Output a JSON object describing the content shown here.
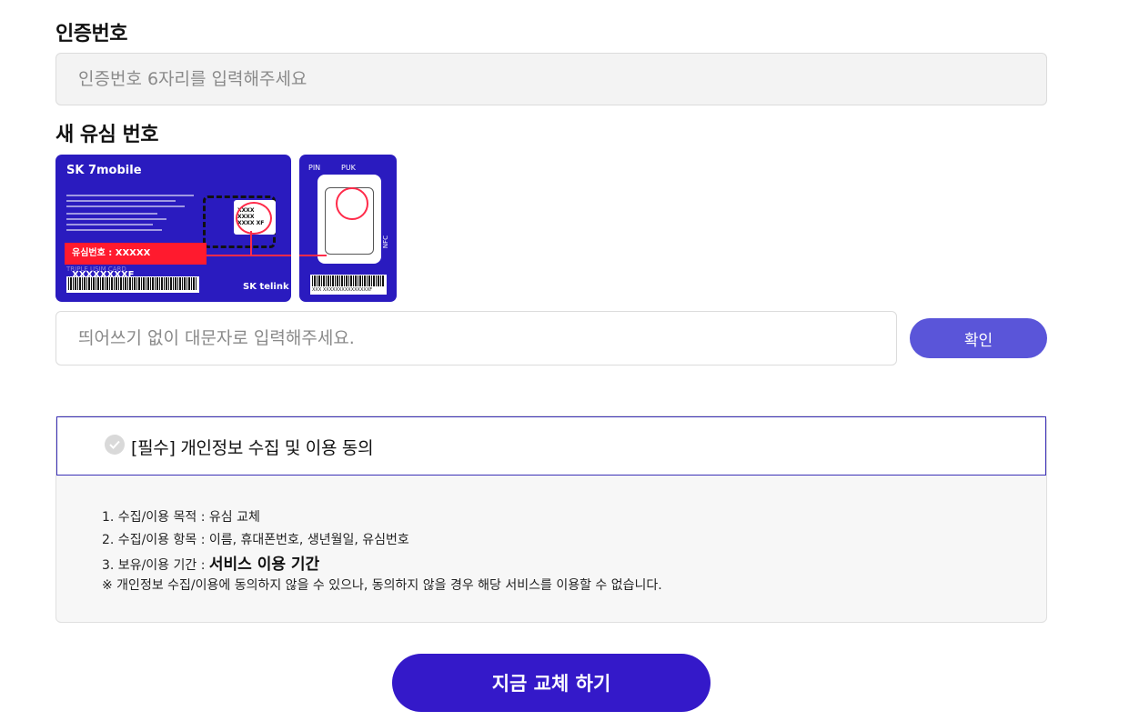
{
  "code_section": {
    "label": "인증번호",
    "placeholder": "인증번호 6자리를 입력해주세요"
  },
  "sim_section": {
    "label": "새 유심 번호",
    "placeholder": "띄어쓰기 없이 대문자로 입력해주세요.",
    "confirm_label": "확인",
    "card_image": {
      "brand": "SK 7mobile",
      "tag": "유심번호 : XXXXX XXXXXXXXF",
      "telink": "SK telink",
      "pin": "PIN",
      "puk": "PUK",
      "nfc": "NFC",
      "card_type": "TRIPLE USIM CARD",
      "barcode_text": "XXX XXXXXXXXXXXXXXXF",
      "mini_text": "XXXX XXXX XXXX XF"
    }
  },
  "agreement": {
    "title": "[필수] 개인정보 수집 및 이용 동의",
    "item1_label": "1. 수집/이용 목적 : ",
    "item1_value": "유심 교체",
    "item2_label": "2. 수집/이용 항목 : ",
    "item2_value": "이름, 휴대폰번호, 생년월일, 유심번호",
    "item3_label": "3. 보유/이용 기간 : ",
    "item3_value": "서비스 이용 기간",
    "note": "※ 개인정보 수집/이용에 동의하지 않을 수 있으나, 동의하지 않을 경우 해당 서비스를 이용할 수 없습니다."
  },
  "submit_label": "지금 교체 하기",
  "colors": {
    "primary": "#3419c9",
    "confirm": "#5a55d9",
    "card": "#2a1bbf",
    "highlight": "#ff1a2e"
  }
}
